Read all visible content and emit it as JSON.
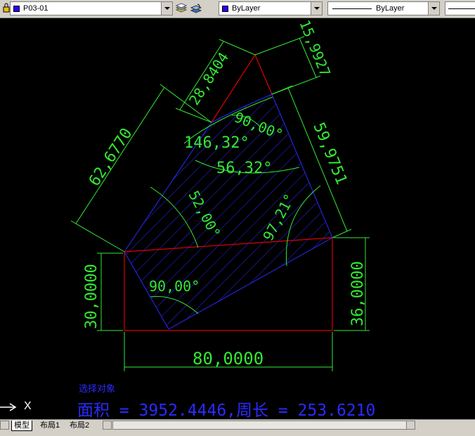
{
  "toolbar": {
    "layer_name": "P03-01",
    "color_value": "ByLayer",
    "linetype_value": "ByLayer",
    "colors": {
      "layer_swatch": "#2a00ff"
    }
  },
  "drawing": {
    "dimensions": {
      "bottom_width": "80,0000",
      "left_height": "30,0000",
      "right_height": "36,0000",
      "diag_left": "62,6770",
      "top_left": "28,8404",
      "top_right": "15,9927",
      "right_diag": "59,9751"
    },
    "angles": {
      "a90_top": "90,00°",
      "a146": "146,32°",
      "a56": "56,32°",
      "a52": "52,00°",
      "a97": "97,21°",
      "a90_bottom": "90,00°"
    },
    "colors": {
      "outline": "#e00000",
      "hatch": "#2a2aff",
      "dimension": "#33e833",
      "cmd_text": "#2a2aff"
    }
  },
  "command": {
    "prompt": "选择对象",
    "result": "面积 = 3952.4446,周长 = 253.6210"
  },
  "ucs": {
    "x_label": "X"
  },
  "tabs": [
    {
      "label": "模型",
      "active": true
    },
    {
      "label": "布局1",
      "active": false
    },
    {
      "label": "布局2",
      "active": false
    }
  ]
}
